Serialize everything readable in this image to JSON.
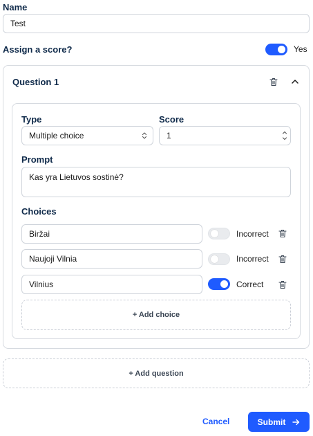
{
  "form": {
    "name_label": "Name",
    "name_value": "Test",
    "assign_score_label": "Assign a score?",
    "assign_score_state": "Yes",
    "assign_score_on": true
  },
  "question": {
    "title": "Question 1",
    "type_label": "Type",
    "type_value": "Multiple choice",
    "score_label": "Score",
    "score_value": "1",
    "prompt_label": "Prompt",
    "prompt_value": "Kas yra Lietuvos sostinė?",
    "choices_label": "Choices",
    "choices": [
      {
        "text": "Biržai",
        "status": "Incorrect",
        "correct": false
      },
      {
        "text": "Naujoji Vilnia",
        "status": "Incorrect",
        "correct": false
      },
      {
        "text": "Vilnius",
        "status": "Correct",
        "correct": true
      }
    ],
    "add_choice_label": "+ Add choice"
  },
  "add_question_label": "+ Add question",
  "footer": {
    "cancel_label": "Cancel",
    "submit_label": "Submit",
    "submit_icon": "arrow-right-icon"
  },
  "colors": {
    "accent": "#1f5bff",
    "heading": "#0f2a4a",
    "border": "#cfd4db"
  }
}
